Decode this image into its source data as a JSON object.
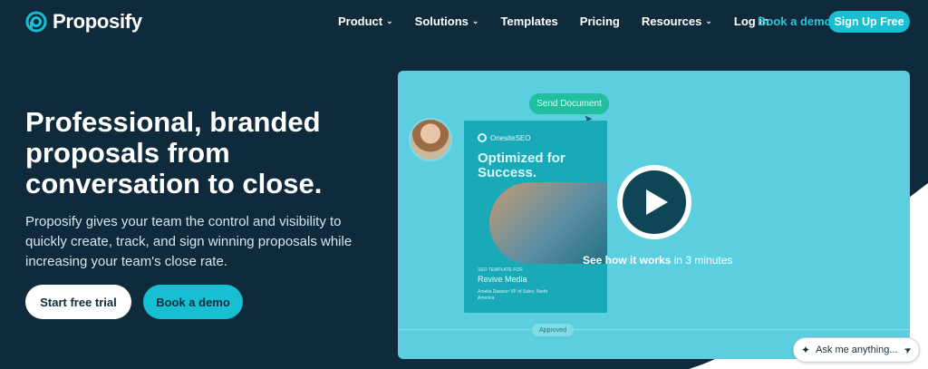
{
  "brand": {
    "name": "Proposify"
  },
  "nav": {
    "items": [
      {
        "label": "Product",
        "has_dropdown": true
      },
      {
        "label": "Solutions",
        "has_dropdown": true
      },
      {
        "label": "Templates",
        "has_dropdown": false
      },
      {
        "label": "Pricing",
        "has_dropdown": false
      },
      {
        "label": "Resources",
        "has_dropdown": true
      },
      {
        "label": "Log in",
        "has_dropdown": false
      }
    ],
    "book_demo_label": "Book a demo",
    "signup_label": "Sign Up Free"
  },
  "hero": {
    "title": "Professional, branded proposals from conversation to close.",
    "subtitle": "Proposify gives your team the control and visibility to quickly create, track, and sign winning proposals while increasing your team's close rate.",
    "cta_primary": "Start free trial",
    "cta_secondary": "Book a demo"
  },
  "video": {
    "send_label": "Send Document",
    "doc_brand": "OnesiteSEO",
    "doc_title": "Optimized for Success.",
    "doc_small": "SEO TEMPLATE FOR",
    "doc_client": "Revive Media",
    "doc_contact": "Amelia Dawson VP of Sales, North America",
    "caption_strong": "See how it works",
    "caption_rest": "in 3 minutes",
    "approved_label": "Approved"
  },
  "chat": {
    "placeholder": "Ask me anything..."
  },
  "colors": {
    "background": "#0f2a3a",
    "accent": "#16bfd1",
    "video_bg": "#5bcfe0"
  }
}
